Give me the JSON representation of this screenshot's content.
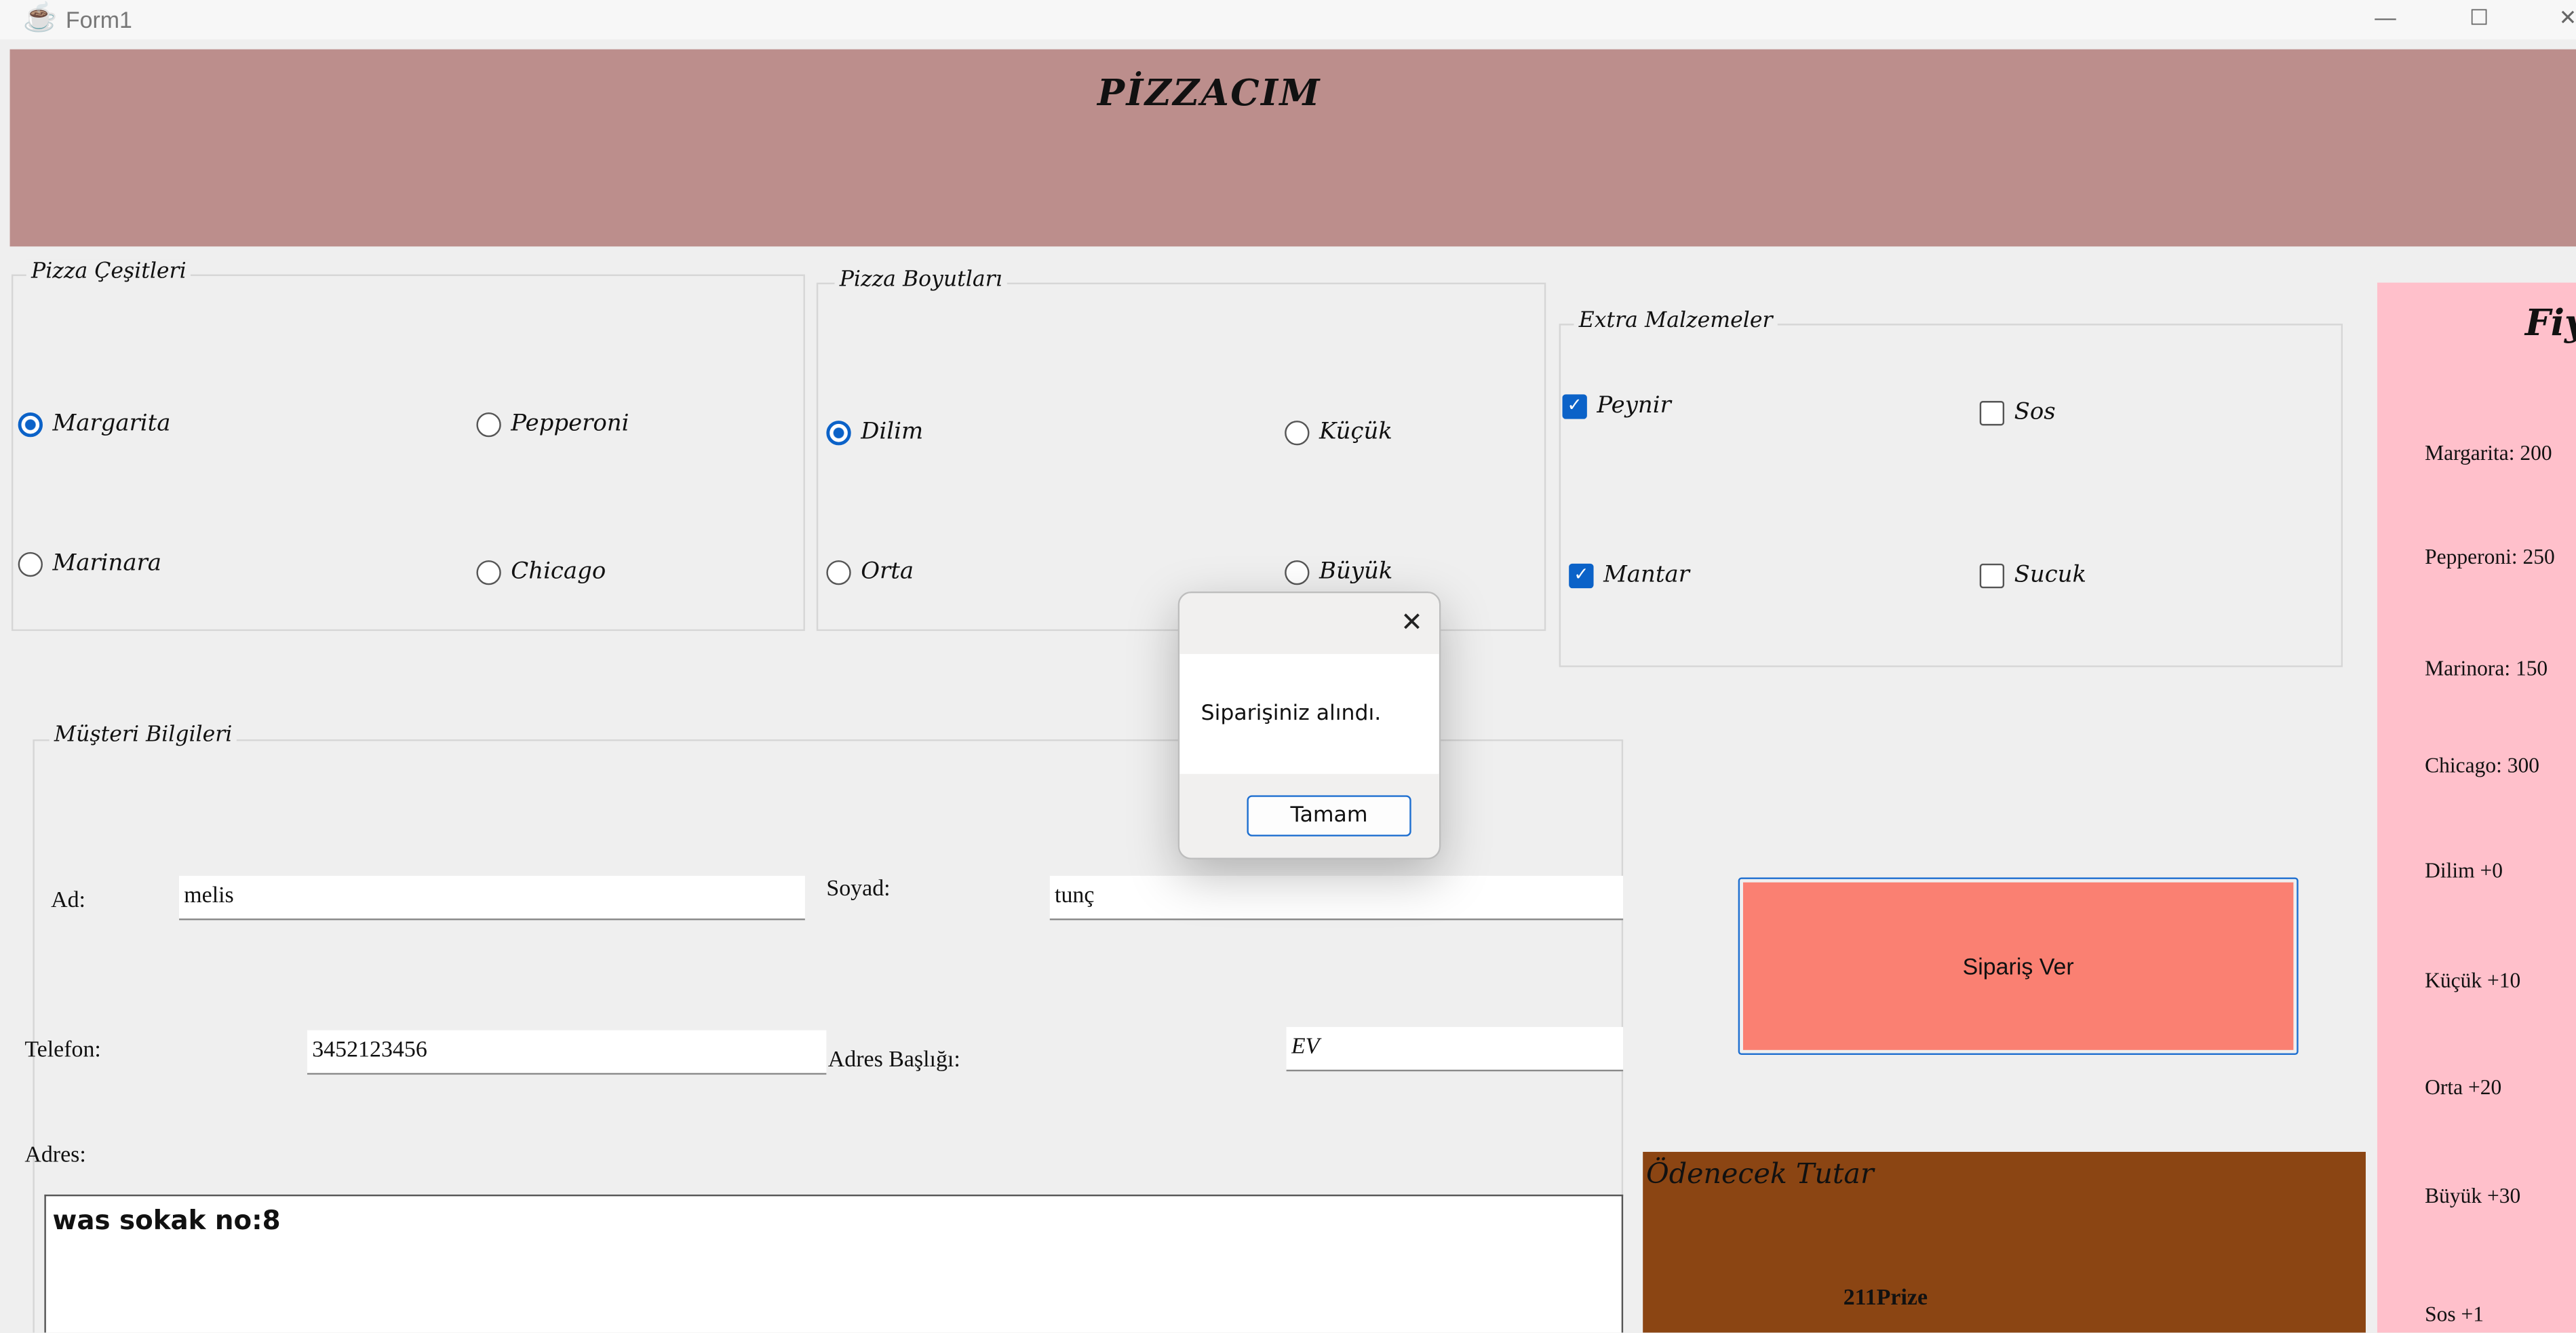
{
  "window": {
    "title": "Form1",
    "controls": {
      "minimize": "—",
      "maximize": "☐",
      "close": "✕"
    }
  },
  "header": {
    "title": "PİZZACIM"
  },
  "pizza_types": {
    "label": "Pizza Çeşitleri",
    "options": [
      {
        "label": "Margarita",
        "selected": true
      },
      {
        "label": "Pepperoni",
        "selected": false
      },
      {
        "label": "Marinara",
        "selected": false
      },
      {
        "label": "Chicago",
        "selected": false
      }
    ]
  },
  "pizza_sizes": {
    "label": "Pizza Boyutları",
    "options": [
      {
        "label": "Dilim",
        "selected": true
      },
      {
        "label": "Küçük",
        "selected": false
      },
      {
        "label": "Orta",
        "selected": false
      },
      {
        "label": "Büyük",
        "selected": false
      }
    ]
  },
  "extras": {
    "label": "Extra Malzemeler",
    "options": [
      {
        "label": "Peynir",
        "checked": true
      },
      {
        "label": "Sos",
        "checked": false
      },
      {
        "label": "Mantar",
        "checked": true
      },
      {
        "label": "Sucuk",
        "checked": false
      }
    ]
  },
  "customer": {
    "label": "Müşteri Bilgileri",
    "first_name_label": "Ad:",
    "first_name": "melis",
    "last_name_label": "Soyad:",
    "last_name": "tunç",
    "phone_label": "Telefon:",
    "phone": "3452123456",
    "address_title_label": "Adres Başlığı:",
    "address_title": "EV",
    "address_label": "Adres:",
    "address": "was sokak no:8"
  },
  "order_button": {
    "label": "Sipariş Ver"
  },
  "payment": {
    "label": "Ödenecek Tutar",
    "amount": "211Prize"
  },
  "price_list": {
    "title": "Fiyatlar",
    "items": [
      "Margarita: 200",
      "Pepperoni: 250",
      "Marinora: 150",
      "Chicago: 300",
      "Dilim +0",
      "Küçük +10",
      "Orta +20",
      "Büyük +30",
      "Sos +1"
    ]
  },
  "dialog": {
    "message": "Siparişiniz alındı.",
    "ok_label": "Tamam",
    "close": "✕"
  },
  "colors": {
    "header_bg": "#bc8e8c",
    "order_button": "#fa8072",
    "payment_bg": "#8b4513",
    "price_panel": "#ffc0cb",
    "accent": "#0b62c8"
  }
}
